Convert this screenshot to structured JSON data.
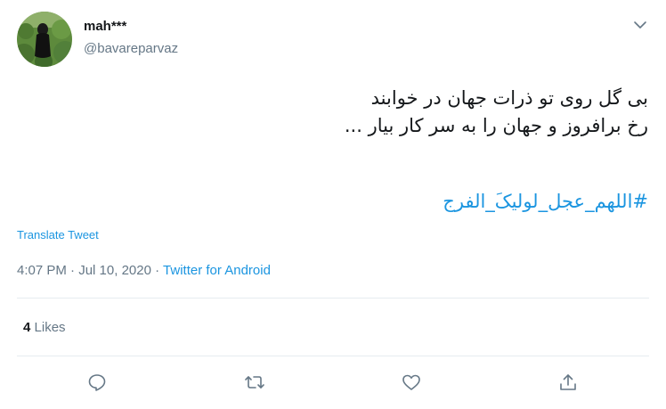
{
  "user": {
    "name": "mah***",
    "handle": "@bavareparvaz"
  },
  "tweet": {
    "line1": "بی گل روی تو ذرات جهان در خوابند",
    "line2": "رخ برافروز و جهان را  به سر کار بیار ...",
    "hashtag": "#اللهم_عجل_لولیکَ_الفرج"
  },
  "translate_label": "Translate Tweet",
  "meta": {
    "time": "4:07 PM",
    "separator": "·",
    "date": "Jul 10, 2020",
    "source": "Twitter for Android"
  },
  "stats": {
    "likes_count": "4",
    "likes_label": "Likes"
  },
  "icons": {
    "more": "chevron-down-icon",
    "reply": "reply-icon",
    "retweet": "retweet-icon",
    "like": "heart-icon",
    "share": "share-icon"
  },
  "colors": {
    "link": "#1b95e0",
    "secondary_text": "#657786",
    "primary_text": "#14171a",
    "divider": "#e6ecf0"
  }
}
